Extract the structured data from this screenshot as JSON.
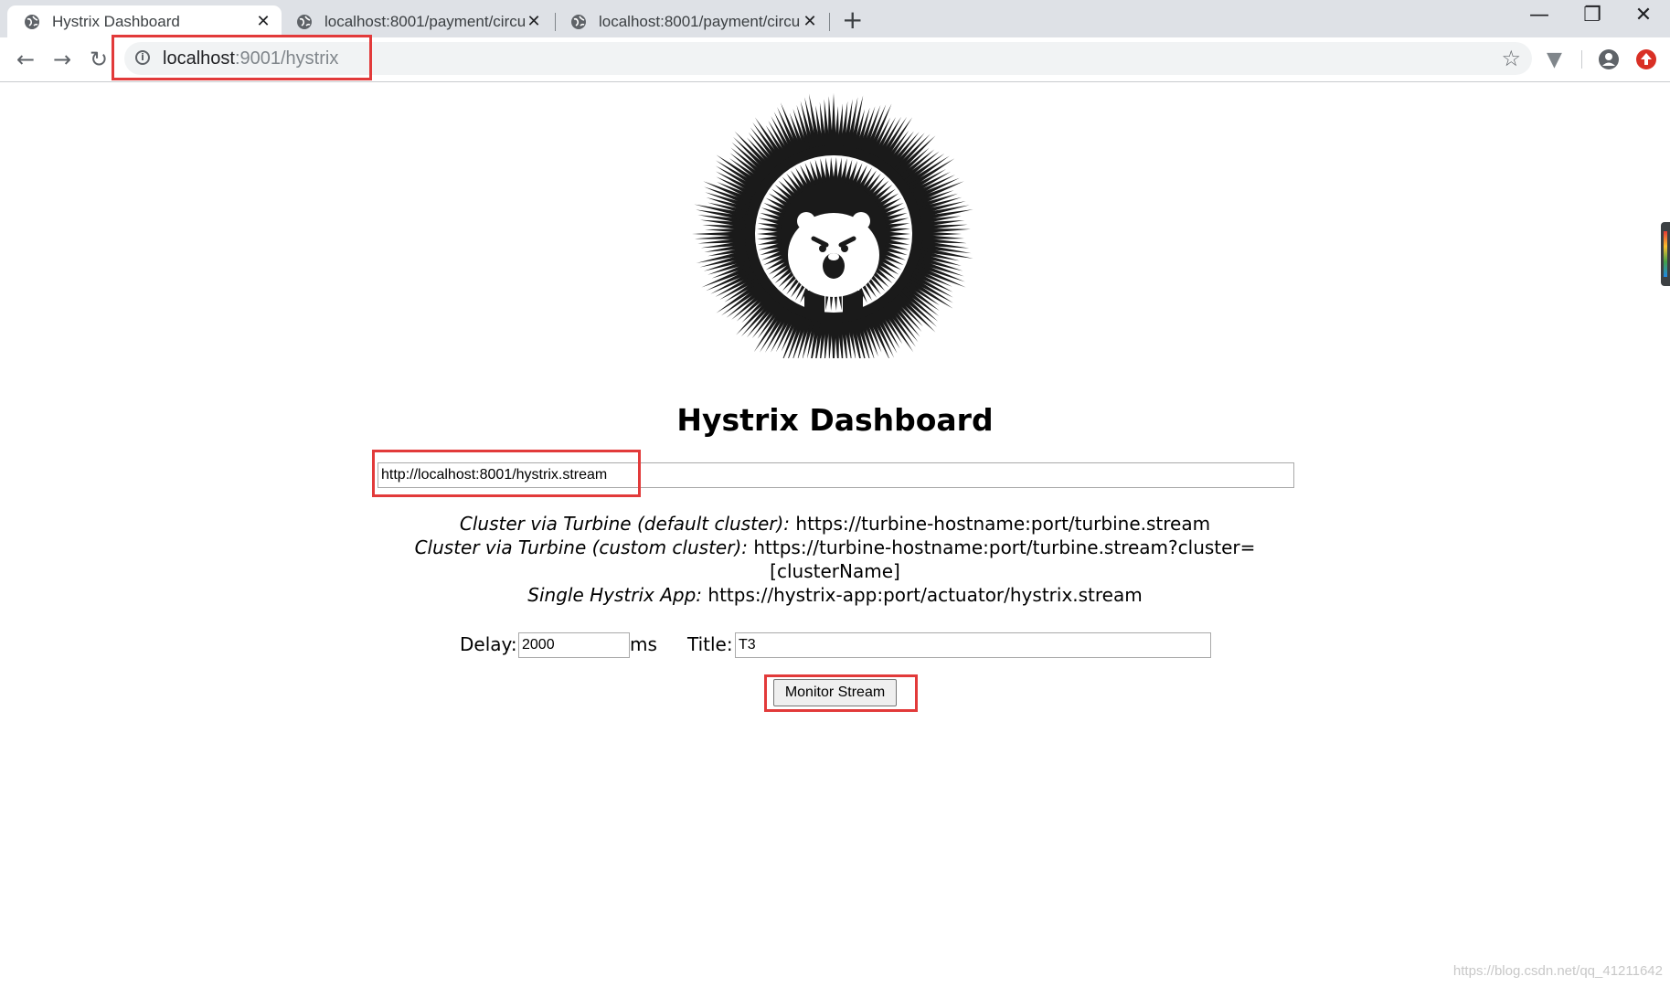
{
  "browser": {
    "tabs": [
      {
        "label": "Hystrix Dashboard",
        "active": true
      },
      {
        "label": "localhost:8001/payment/circui",
        "active": false
      },
      {
        "label": "localhost:8001/payment/circui",
        "active": false
      }
    ],
    "new_tab_symbol": "+",
    "url_host": "localhost",
    "url_rest": ":9001/hystrix",
    "window_controls": [
      "minimize-icon",
      "restore-icon",
      "close-icon"
    ]
  },
  "page": {
    "title": "Hystrix Dashboard",
    "stream_url": "http://localhost:8001/hystrix.stream",
    "hints": [
      {
        "label": "Cluster via Turbine (default cluster):",
        "value": "https://turbine-hostname:port/turbine.stream"
      },
      {
        "label": "Cluster via Turbine (custom cluster):",
        "value": "https://turbine-hostname:port/turbine.stream?cluster="
      },
      {
        "label": "",
        "value": "[clusterName]"
      },
      {
        "label": "Single Hystrix App:",
        "value": "https://hystrix-app:port/actuator/hystrix.stream"
      }
    ],
    "delay_label": "Delay:",
    "delay_value": "2000",
    "delay_unit": "ms",
    "title_label": "Title:",
    "title_value": "T3",
    "monitor_button": "Monitor Stream"
  },
  "watermark": "https://blog.csdn.net/qq_41211642",
  "colors": {
    "highlight": "#e23a3a",
    "tabbar": "#dee1e6"
  }
}
